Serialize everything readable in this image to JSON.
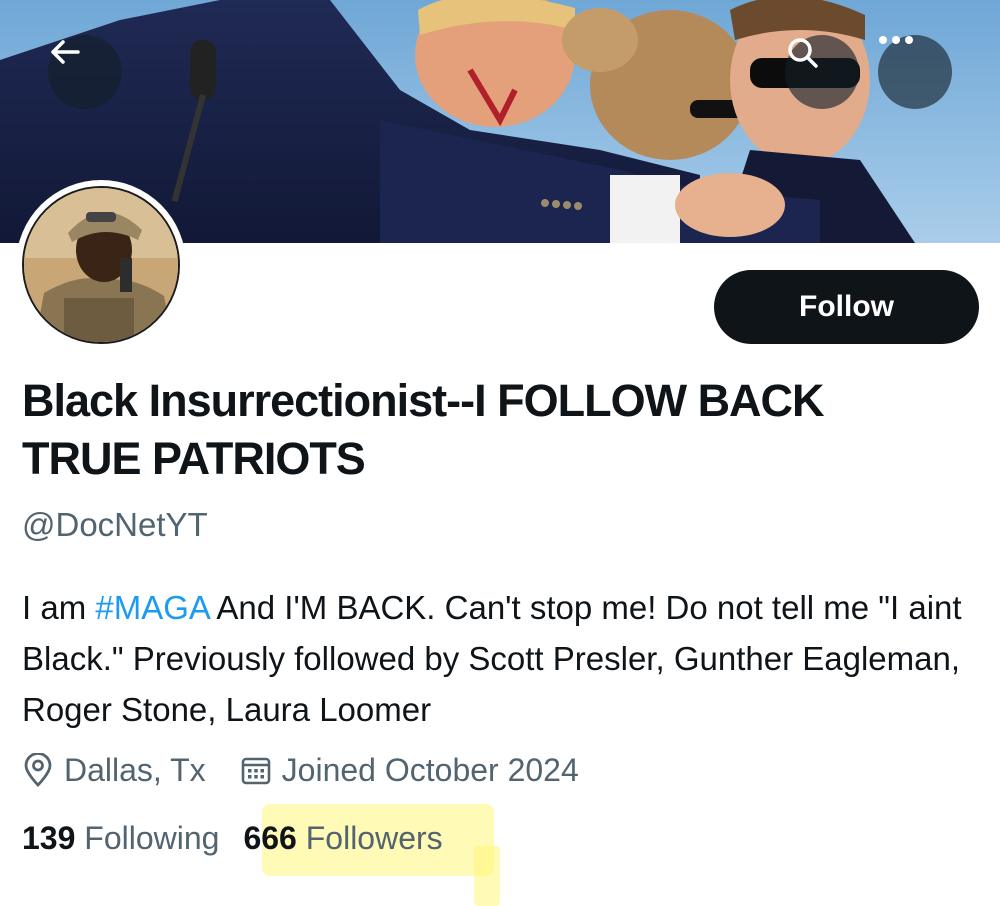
{
  "header": {
    "back_icon": "arrow-left-icon",
    "search_icon": "search-icon",
    "more_icon": "more-horizontal-icon"
  },
  "profile": {
    "display_name": "Black Insurrectionist--I FOLLOW BACK TRUE PATRIOTS",
    "handle": "@DocNetYT",
    "follow_label": "Follow",
    "bio": {
      "prefix": "I am ",
      "hashtag": "#MAGA",
      "suffix": " And I'M BACK. Can't stop me! Do not tell me \"I aint Black.\" Previously followed by Scott Presler, Gunther Eagleman, Roger Stone, Laura Loomer"
    },
    "location": "Dallas, Tx",
    "joined": "Joined October 2024",
    "location_icon": "location-pin-icon",
    "calendar_icon": "calendar-icon"
  },
  "stats": {
    "following_count": "139",
    "following_label": "Following",
    "followers_count": "666",
    "followers_label": "Followers"
  },
  "colors": {
    "accent": "#1d9bf0",
    "text_primary": "#0f1419",
    "text_secondary": "#536471",
    "follow_button_bg": "#0f1419",
    "highlight": "#fff678"
  }
}
